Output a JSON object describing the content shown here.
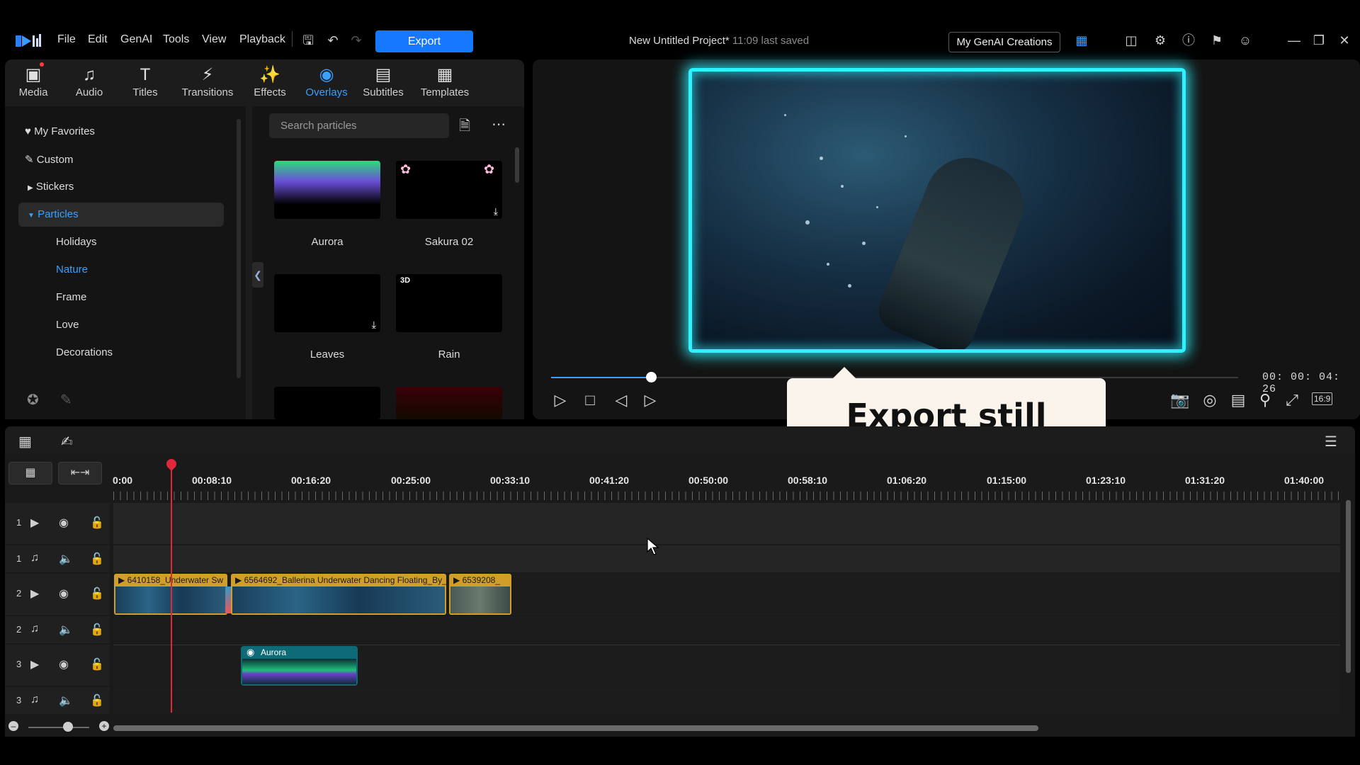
{
  "app": {
    "menu": [
      "File",
      "Edit",
      "GenAI",
      "Tools",
      "View",
      "Playback"
    ],
    "export_label": "Export",
    "project_title": "New Untitled Project*",
    "last_saved": "11:09 last saved",
    "genai_button": "My GenAI Creations"
  },
  "library": {
    "tabs": [
      "Media",
      "Audio",
      "Titles",
      "Transitions",
      "Effects",
      "Overlays",
      "Subtitles",
      "Templates"
    ],
    "active_tab": "Overlays",
    "tree": {
      "favorites": "My Favorites",
      "custom": "Custom",
      "stickers": "Stickers",
      "particles": "Particles",
      "children": [
        "Holidays",
        "Nature",
        "Frame",
        "Love",
        "Decorations"
      ],
      "active_child": "Nature"
    },
    "search_placeholder": "Search particles",
    "items": [
      "Aurora",
      "Sakura 02",
      "Leaves",
      "Rain"
    ],
    "badge_3d": "3D"
  },
  "preview": {
    "timecode": "00: 00: 04: 26",
    "progress": 0.145,
    "tooltip": "Export still frame",
    "aspect": "16:9"
  },
  "timeline": {
    "ruler": [
      "0:00",
      "00:08:10",
      "00:16:20",
      "00:25:00",
      "00:33:10",
      "00:41:20",
      "00:50:00",
      "00:58:10",
      "01:06:20",
      "01:15:00",
      "01:23:10",
      "01:31:20",
      "01:40:00"
    ],
    "tracks": [
      "1",
      "1",
      "2",
      "2",
      "3",
      "3"
    ],
    "clips": {
      "c1": "6410158_Underwater Sw",
      "c2": "6564692_Ballerina Underwater Dancing Floating_By_",
      "c3": "6539208_",
      "aurora": "Aurora"
    }
  }
}
